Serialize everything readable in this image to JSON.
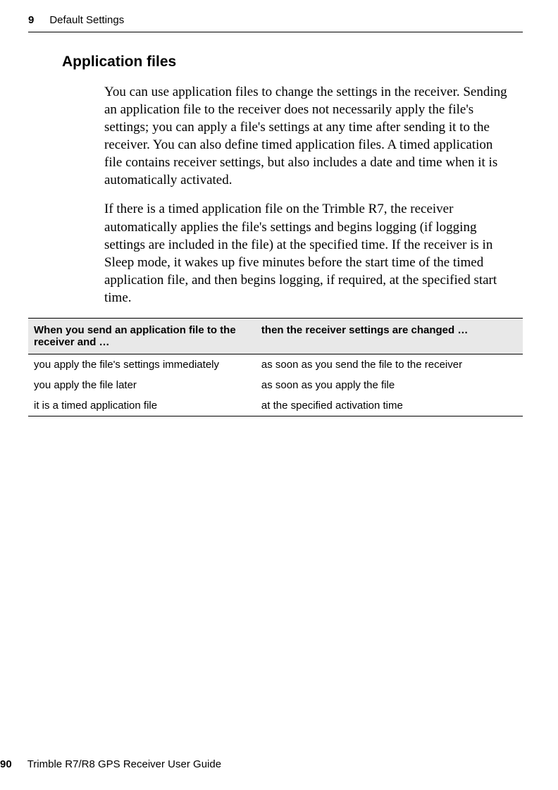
{
  "header": {
    "chapter_number": "9",
    "chapter_title": "Default Settings"
  },
  "section": {
    "title": "Application files"
  },
  "paragraphs": {
    "p1": "You can use application files to change the settings in the receiver. Sending an application file to the receiver does not necessarily apply the file's settings; you can apply a file's settings at any time after sending it to the receiver. You can also define timed application files. A timed application file contains receiver settings, but also includes a date and time when it is automatically activated.",
    "p2": "If there is a timed application file on the Trimble R7, the receiver automatically applies the file's settings and begins logging (if logging settings are included in the file) at the specified time. If the receiver is in Sleep mode, it wakes up five minutes before the start time of the timed application file, and then begins logging, if required, at the specified start time."
  },
  "table": {
    "header_left": "When you send an application file to the receiver and …",
    "header_right": "then the receiver settings are changed …",
    "rows": [
      {
        "left": "you apply the file's settings immediately",
        "right": "as soon as you send the file to the receiver"
      },
      {
        "left": "you apply the file later",
        "right": "as soon as you apply the file"
      },
      {
        "left": "it is a timed application file",
        "right": "at the specified activation time"
      }
    ]
  },
  "footer": {
    "page_number": "90",
    "doc_title": "Trimble R7/R8 GPS Receiver User Guide"
  }
}
